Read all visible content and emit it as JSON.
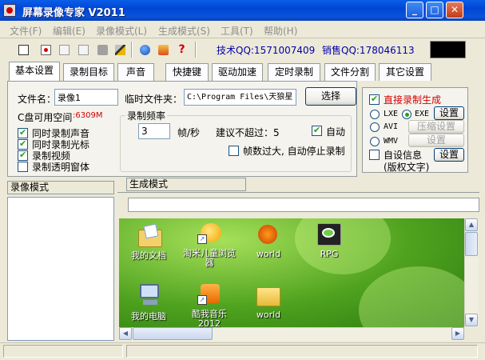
{
  "window": {
    "title": "屏幕录像专家 V2011",
    "minimize": "_",
    "maximize": "□",
    "close": "✕"
  },
  "menu": [
    "文件(F)",
    "编辑(E)",
    "录像模式(L)",
    "生成模式(S)",
    "工具(T)",
    "帮助(H)"
  ],
  "toolbar": {
    "icons": [
      "new-file-icon",
      "record-icon",
      "pause-icon",
      "stop-icon",
      "camera-icon",
      "settings-icon",
      "globe-icon",
      "tools-icon",
      "help-icon"
    ],
    "qq_tech": "技术QQ:1571007409",
    "qq_sales": "销售QQ:178046113"
  },
  "tabs": [
    "基本设置",
    "录制目标",
    "声音",
    "快捷键",
    "驱动加速",
    "定时录制",
    "文件分割",
    "其它设置"
  ],
  "basic": {
    "filename_label": "文件名：",
    "filename_value": "录像1",
    "tempdir_label": "临时文件夹：",
    "tempdir_value": "C:\\Program Files\\天狼星",
    "browse_button": "选择",
    "disk_label": "C盘可用空间",
    "disk_value": ":6309M",
    "options": [
      {
        "label": "同时录制声音",
        "checked": true
      },
      {
        "label": "同时录制光标",
        "checked": true
      },
      {
        "label": "录制视频",
        "checked": true
      },
      {
        "label": "录制透明窗体",
        "checked": false
      }
    ],
    "freq": {
      "legend": "录制频率",
      "value": "3",
      "unit": "帧/秒",
      "hint": "建议不超过：5",
      "auto_label": "自动",
      "auto_checked": true,
      "stop_label": "帧数过大, 自动停止录制",
      "stop_checked": false
    }
  },
  "right": {
    "direct_label": "直接录制生成",
    "direct_checked": true,
    "formats": [
      {
        "label": "LXE",
        "checked": false
      },
      {
        "label": "EXE",
        "checked": true
      },
      {
        "label": "AVI",
        "checked": false
      },
      {
        "label": "WMV",
        "checked": false
      }
    ],
    "settings_button": "设置",
    "compress_button": "压缩设置",
    "settings2_button": "设置",
    "custom_label": "自设信息",
    "custom_sub": "(版权文字)",
    "custom_checked": false,
    "settings3_button": "设置"
  },
  "panes": {
    "record_mode": "录像模式",
    "generate_mode": "生成模式"
  },
  "desktop": [
    {
      "name": "我的文档",
      "icon": "my-documents-icon"
    },
    {
      "name": "淘米儿童浏览器",
      "icon": "taomi-browser-icon"
    },
    {
      "name": "world",
      "icon": "world-app-icon"
    },
    {
      "name": "RPG",
      "icon": "rpg-icon"
    },
    {
      "name": "我的电脑",
      "icon": "my-computer-icon"
    },
    {
      "name": "酷我音乐2012",
      "icon": "kuwo-music-icon"
    },
    {
      "name": "world",
      "icon": "folder-icon"
    }
  ],
  "colors": {
    "title_blue": "#0046d5",
    "desktop_green": "#4fa21e",
    "qq_blue": "#0000a8",
    "accent_red": "#d40000"
  }
}
